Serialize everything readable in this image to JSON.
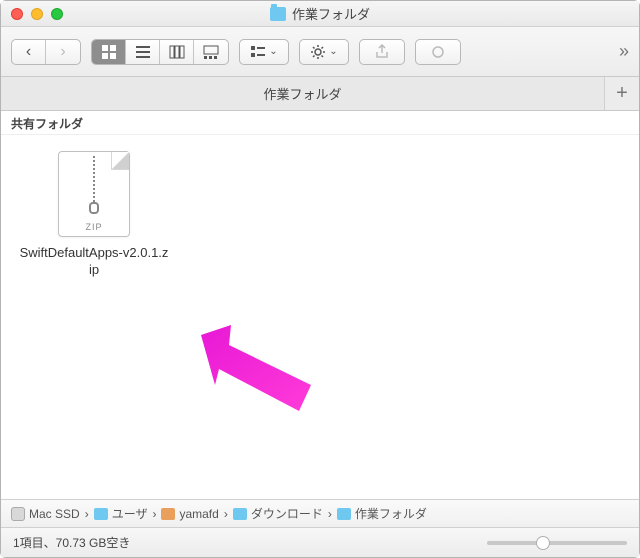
{
  "window": {
    "title": "作業フォルダ",
    "tab_label": "作業フォルダ",
    "shared_label": "共有フォルダ"
  },
  "file": {
    "name": "SwiftDefaultApps-v2.0.1.zip",
    "badge": "ZIP"
  },
  "path": {
    "disk": "Mac SSD",
    "users": "ユーザ",
    "home": "yamafd",
    "downloads": "ダウンロード",
    "folder": "作業フォルダ"
  },
  "status": {
    "text": "1項目、70.73 GB空き"
  },
  "icons": {
    "grid": "grid-icon",
    "list": "list-icon",
    "columns": "columns-icon",
    "gallery": "gallery-icon",
    "group": "group-icon",
    "action": "gear-icon",
    "share": "share-icon",
    "tag": "tag-icon"
  }
}
